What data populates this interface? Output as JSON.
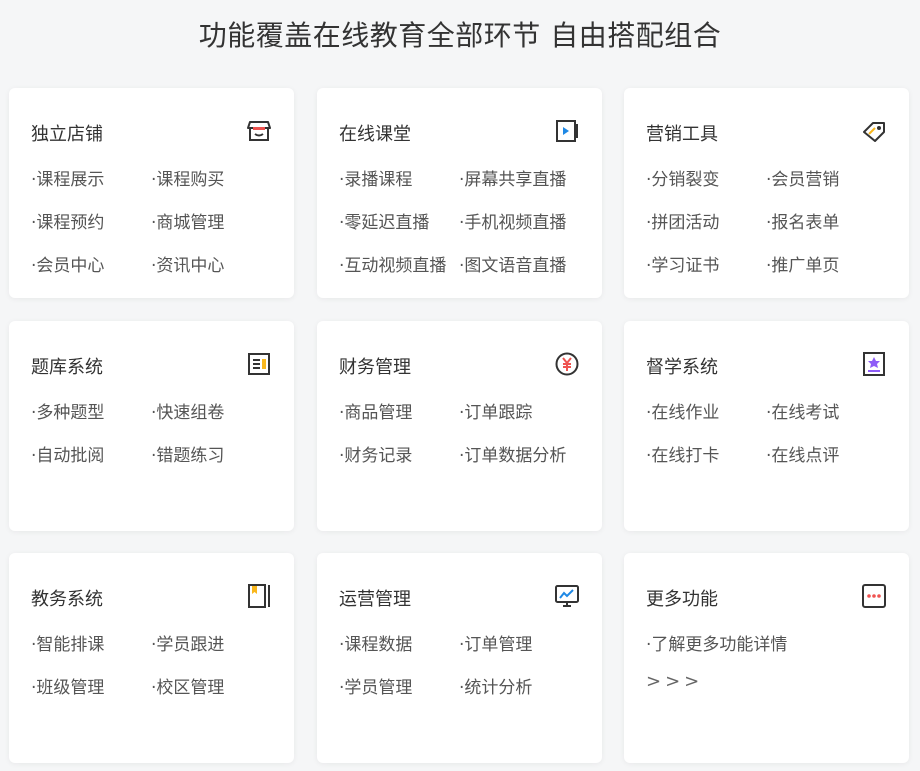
{
  "page_title": "功能覆盖在线教育全部环节 自由搭配组合",
  "cards": [
    {
      "title": "独立店铺",
      "icon": "store-icon",
      "items": [
        "·课程展示",
        "·课程购买",
        "·课程预约",
        "·商城管理",
        "·会员中心",
        "·资讯中心"
      ]
    },
    {
      "title": "在线课堂",
      "icon": "video-play-icon",
      "items": [
        "·录播课程",
        "·屏幕共享直播",
        "·零延迟直播",
        "·手机视频直播",
        "·互动视频直播",
        "·图文语音直播"
      ]
    },
    {
      "title": "营销工具",
      "icon": "tag-icon",
      "items": [
        "·分销裂变",
        "·会员营销",
        "·拼团活动",
        "·报名表单",
        "·学习证书",
        "·推广单页"
      ]
    },
    {
      "title": "题库系统",
      "icon": "question-bank-icon",
      "items": [
        "·多种题型",
        "·快速组卷",
        "·自动批阅",
        "·错题练习"
      ]
    },
    {
      "title": "财务管理",
      "icon": "yen-coin-icon",
      "items": [
        "·商品管理",
        "·订单跟踪",
        "·财务记录",
        "·订单数据分析"
      ]
    },
    {
      "title": "督学系统",
      "icon": "badge-icon",
      "items": [
        "·在线作业",
        "·在线考试",
        "·在线打卡",
        "·在线点评"
      ]
    },
    {
      "title": "教务系统",
      "icon": "notebook-icon",
      "items": [
        "·智能排课",
        "·学员跟进",
        "·班级管理",
        "·校区管理"
      ]
    },
    {
      "title": "运营管理",
      "icon": "monitor-chart-icon",
      "items": [
        "·课程数据",
        "·订单管理",
        "·学员管理",
        "·统计分析"
      ]
    },
    {
      "title": "更多功能",
      "icon": "more-dots-icon",
      "items": [
        "·了解更多功能详情"
      ],
      "arrows": ">>>"
    }
  ],
  "colors": {
    "accent_blue": "#1e88e5",
    "accent_red": "#ef5350",
    "accent_purple": "#8e5cf7",
    "accent_yellow": "#f9b71c"
  }
}
